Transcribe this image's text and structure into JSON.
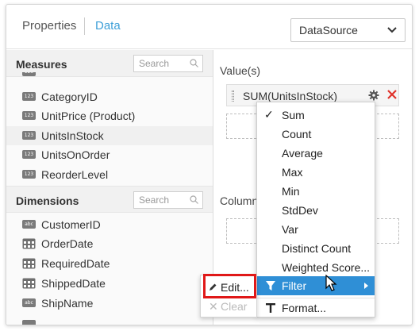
{
  "tabs": {
    "properties": "Properties",
    "data": "Data"
  },
  "datasource": {
    "value": "DataSource"
  },
  "measures": {
    "title": "Measures",
    "search_placeholder": "Search",
    "items": [
      {
        "label": "CategoryID",
        "badge": "123"
      },
      {
        "label": "UnitPrice (Product)",
        "badge": "123"
      },
      {
        "label": "UnitsInStock",
        "badge": "123",
        "selected": true
      },
      {
        "label": "UnitsOnOrder",
        "badge": "123"
      },
      {
        "label": "ReorderLevel",
        "badge": "123"
      }
    ]
  },
  "dimensions": {
    "title": "Dimensions",
    "search_placeholder": "Search",
    "items": [
      {
        "label": "CustomerID",
        "badge": "abc",
        "icon": "text-field-icon"
      },
      {
        "label": "OrderDate",
        "icon": "calendar-icon"
      },
      {
        "label": "RequiredDate",
        "icon": "calendar-icon"
      },
      {
        "label": "ShippedDate",
        "icon": "calendar-icon"
      },
      {
        "label": "ShipName",
        "badge": "abc",
        "icon": "text-field-icon"
      }
    ]
  },
  "values_zone": {
    "label": "Value(s)",
    "chip": "SUM(UnitsInStock)"
  },
  "columns_zone": {
    "label": "Column(s)"
  },
  "aggregation_menu": {
    "items": [
      "Sum",
      "Count",
      "Average",
      "Max",
      "Min",
      "StdDev",
      "Var",
      "Distinct Count",
      "Weighted Score..."
    ],
    "checked": "Sum",
    "filter": "Filter",
    "format": "Format..."
  },
  "filter_submenu": {
    "edit": "Edit...",
    "clear": "Clear"
  },
  "colors": {
    "accent": "#2f8fd6",
    "tab_active": "#3d9fd8",
    "highlight_border": "#e01818",
    "delete": "#e0322b"
  }
}
